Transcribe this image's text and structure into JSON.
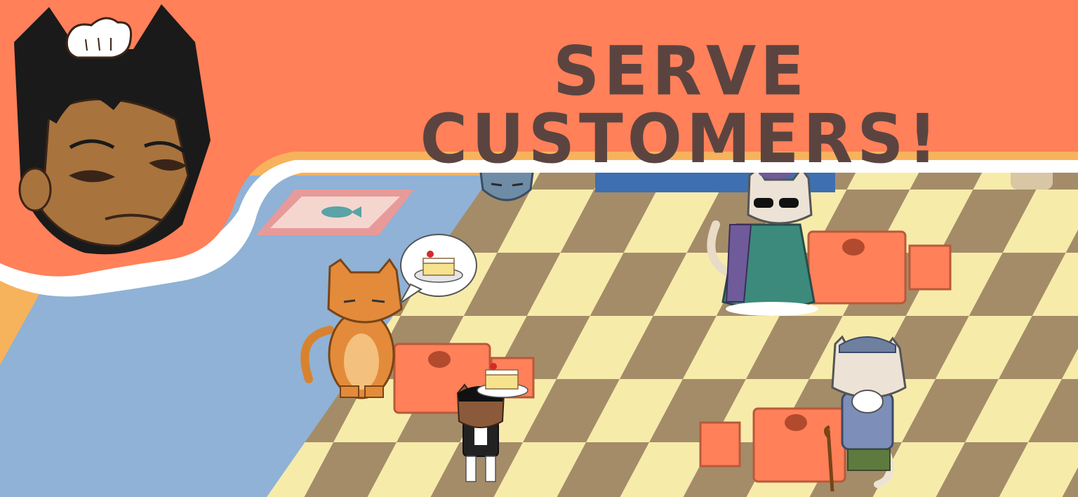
{
  "banner": {
    "title": "SERVE CUSTOMERS!",
    "background_color": "#ff8059",
    "text_color": "#5b4440"
  },
  "scene": {
    "floor_colors": [
      "#f7eeae",
      "#a08a6a"
    ],
    "carpet_color": "#8fb2d6",
    "table_color": "#ff8059",
    "speech_bubble_item": "cake-icon",
    "characters": [
      "waitress-player",
      "orange-cat-customer",
      "rich-lady-cat-customer",
      "old-cat-customer",
      "blue-face-cat"
    ]
  }
}
